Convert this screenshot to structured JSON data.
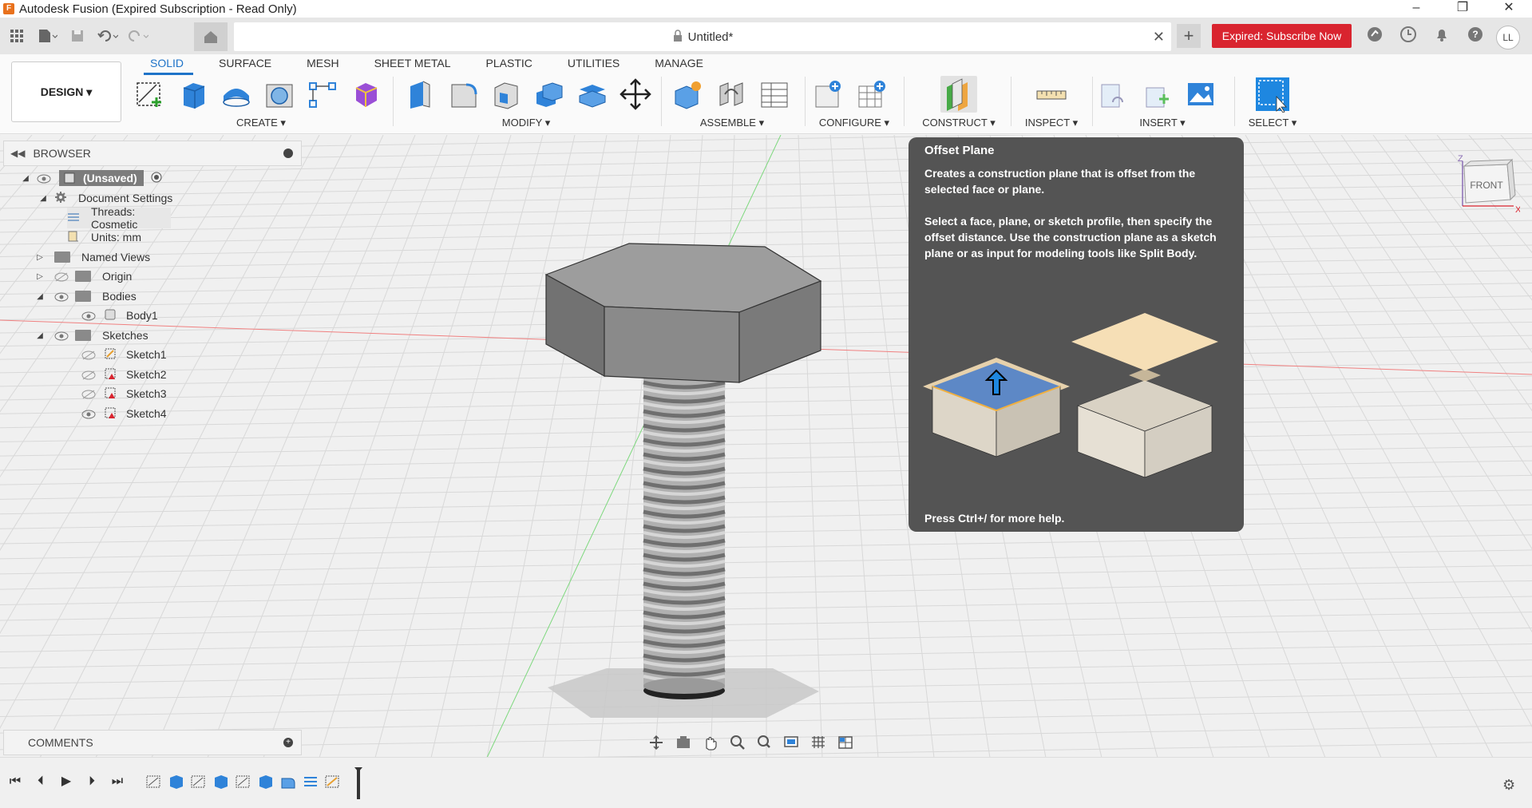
{
  "window": {
    "title": "Autodesk Fusion (Expired Subscription - Read Only)",
    "controls": [
      "–",
      "❐",
      "✕"
    ]
  },
  "tabs": {
    "doc_name": "Untitled*",
    "expired_button": "Expired: Subscribe Now",
    "user_initials": "LL"
  },
  "ribbon": {
    "workspace": "DESIGN ▾",
    "tabs": [
      "SOLID",
      "SURFACE",
      "MESH",
      "SHEET METAL",
      "PLASTIC",
      "UTILITIES",
      "MANAGE"
    ],
    "groups": {
      "create": "CREATE ▾",
      "modify": "MODIFY ▾",
      "assemble": "ASSEMBLE ▾",
      "configure": "CONFIGURE ▾",
      "construct": "CONSTRUCT ▾",
      "inspect": "INSPECT ▾",
      "insert": "INSERT ▾",
      "select": "SELECT ▾"
    }
  },
  "browser": {
    "title": "BROWSER",
    "items": [
      {
        "label": "(Unsaved)"
      },
      {
        "label": "Document Settings"
      },
      {
        "label": "Threads: Cosmetic"
      },
      {
        "label": "Units: mm"
      },
      {
        "label": "Named Views"
      },
      {
        "label": "Origin"
      },
      {
        "label": "Bodies"
      },
      {
        "label": "Body1"
      },
      {
        "label": "Sketches"
      },
      {
        "label": "Sketch1"
      },
      {
        "label": "Sketch2"
      },
      {
        "label": "Sketch3"
      },
      {
        "label": "Sketch4"
      }
    ]
  },
  "comments": {
    "title": "COMMENTS"
  },
  "tooltip": {
    "title": "Offset Plane",
    "description_1": "Creates a construction plane that is offset from the selected face or plane.",
    "description_2": "Select a face, plane, or sketch profile, then specify the offset distance. Use the construction plane as a sketch plane or as input for modeling tools like Split Body.",
    "help": "Press Ctrl+/ for more help."
  },
  "viewcube": {
    "face": "FRONT",
    "axis_z": "Z",
    "axis_x": "X"
  },
  "colors": {
    "accent": "#1e73c8",
    "expired": "#d9242f",
    "tooltip_bg": "#545454"
  }
}
